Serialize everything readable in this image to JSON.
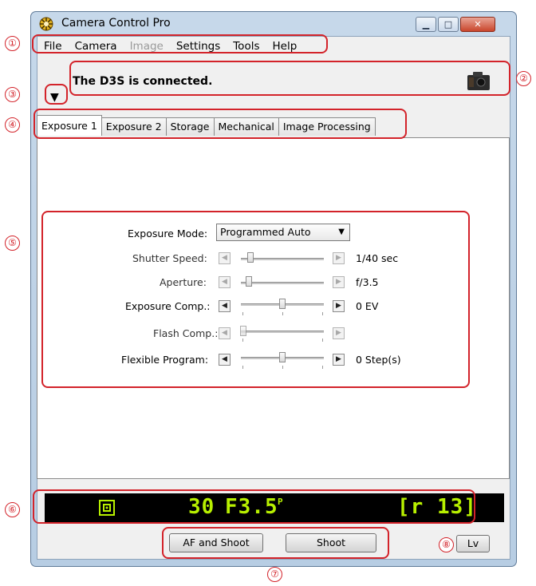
{
  "window": {
    "title": "Camera Control Pro"
  },
  "menu": [
    "File",
    "Camera",
    "Image",
    "Settings",
    "Tools",
    "Help"
  ],
  "status": {
    "text": "The D3S is connected."
  },
  "toggle": {
    "glyph": "▼"
  },
  "tabs": [
    "Exposure 1",
    "Exposure 2",
    "Storage",
    "Mechanical",
    "Image Processing"
  ],
  "exposure": {
    "mode_label": "Exposure Mode:",
    "mode_value": "Programmed Auto",
    "rows": [
      {
        "label": "Shutter Speed:",
        "value": "1/40 sec",
        "enabled": false
      },
      {
        "label": "Aperture:",
        "value": "f/3.5",
        "enabled": false
      },
      {
        "label": "Exposure Comp.:",
        "value": "0 EV",
        "enabled": true
      },
      {
        "label": "Flash Comp.:",
        "value": "",
        "enabled": false
      },
      {
        "label": "Flexible Program:",
        "value": "0 Step(s)",
        "enabled": true
      }
    ]
  },
  "lcd": {
    "shutter": "30",
    "fstop": "F3.5",
    "mode": "P",
    "remaining": "[r 13]",
    "color": "#b8f000"
  },
  "buttons": {
    "af_shoot": "AF and Shoot",
    "shoot": "Shoot",
    "lv": "Lv"
  },
  "annotations": [
    "①",
    "②",
    "③",
    "④",
    "⑤",
    "⑥",
    "⑦",
    "⑧"
  ],
  "colors": {
    "annotation": "#d3232a",
    "lcd_bg": "#000000"
  }
}
